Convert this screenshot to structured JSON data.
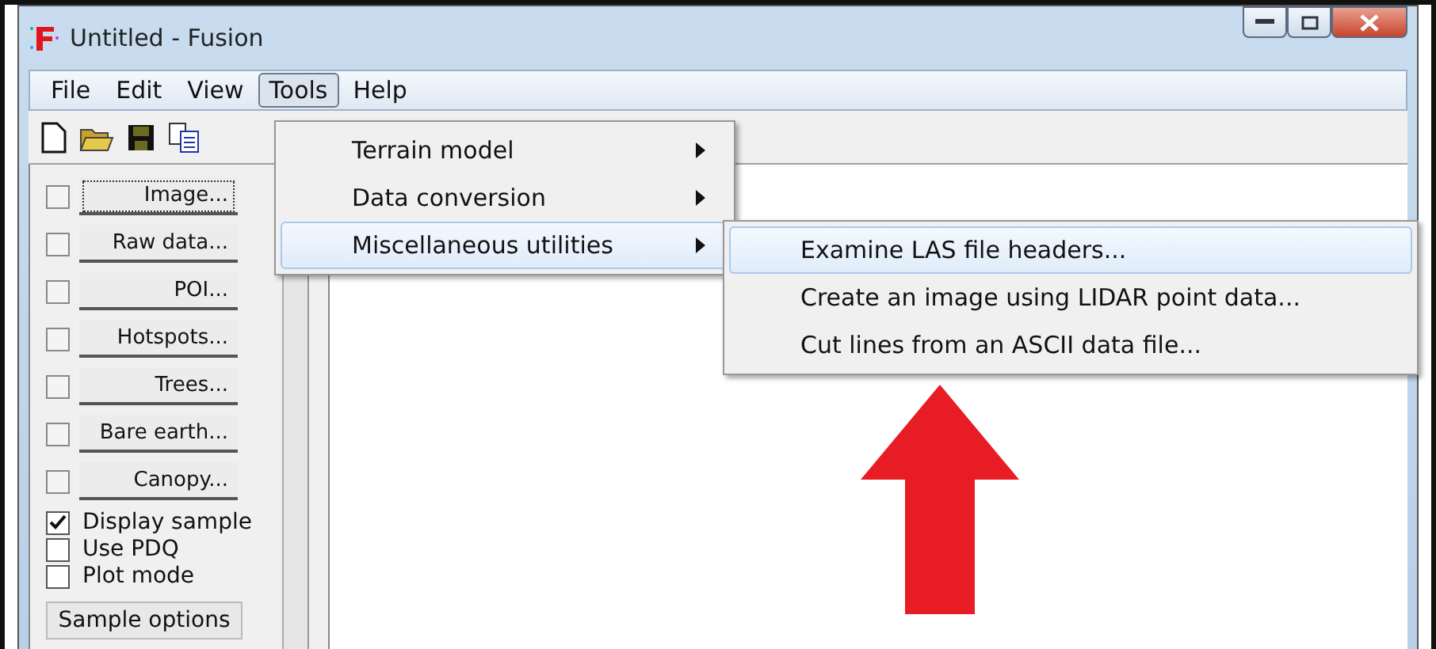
{
  "window": {
    "title": "Untitled - Fusion"
  },
  "menu_bar": [
    {
      "label": "File",
      "selected": false
    },
    {
      "label": "Edit",
      "selected": false
    },
    {
      "label": "View",
      "selected": false
    },
    {
      "label": "Tools",
      "selected": true
    },
    {
      "label": "Help",
      "selected": false
    }
  ],
  "tools_menu": [
    {
      "label": "Terrain model",
      "selected": false
    },
    {
      "label": "Data conversion",
      "selected": false
    },
    {
      "label": "Miscellaneous utilities",
      "selected": true
    }
  ],
  "submenu": [
    {
      "label": "Examine LAS file headers...",
      "selected": true
    },
    {
      "label": "Create an image using LIDAR point data...",
      "selected": false
    },
    {
      "label": "Cut lines from an ASCII data file...",
      "selected": false
    }
  ],
  "layers": [
    {
      "label": "Image...",
      "checked": false,
      "focused": true
    },
    {
      "label": "Raw data...",
      "checked": false,
      "focused": false
    },
    {
      "label": "POI...",
      "checked": false,
      "focused": false
    },
    {
      "label": "Hotspots...",
      "checked": false,
      "focused": false
    },
    {
      "label": "Trees...",
      "checked": false,
      "focused": false
    },
    {
      "label": "Bare earth...",
      "checked": false,
      "focused": false
    },
    {
      "label": "Canopy...",
      "checked": false,
      "focused": false
    }
  ],
  "options": [
    {
      "label": "Display sample",
      "checked": true
    },
    {
      "label": "Use PDQ",
      "checked": false
    },
    {
      "label": "Plot mode",
      "checked": false
    }
  ],
  "sample_options_button": "Sample options"
}
